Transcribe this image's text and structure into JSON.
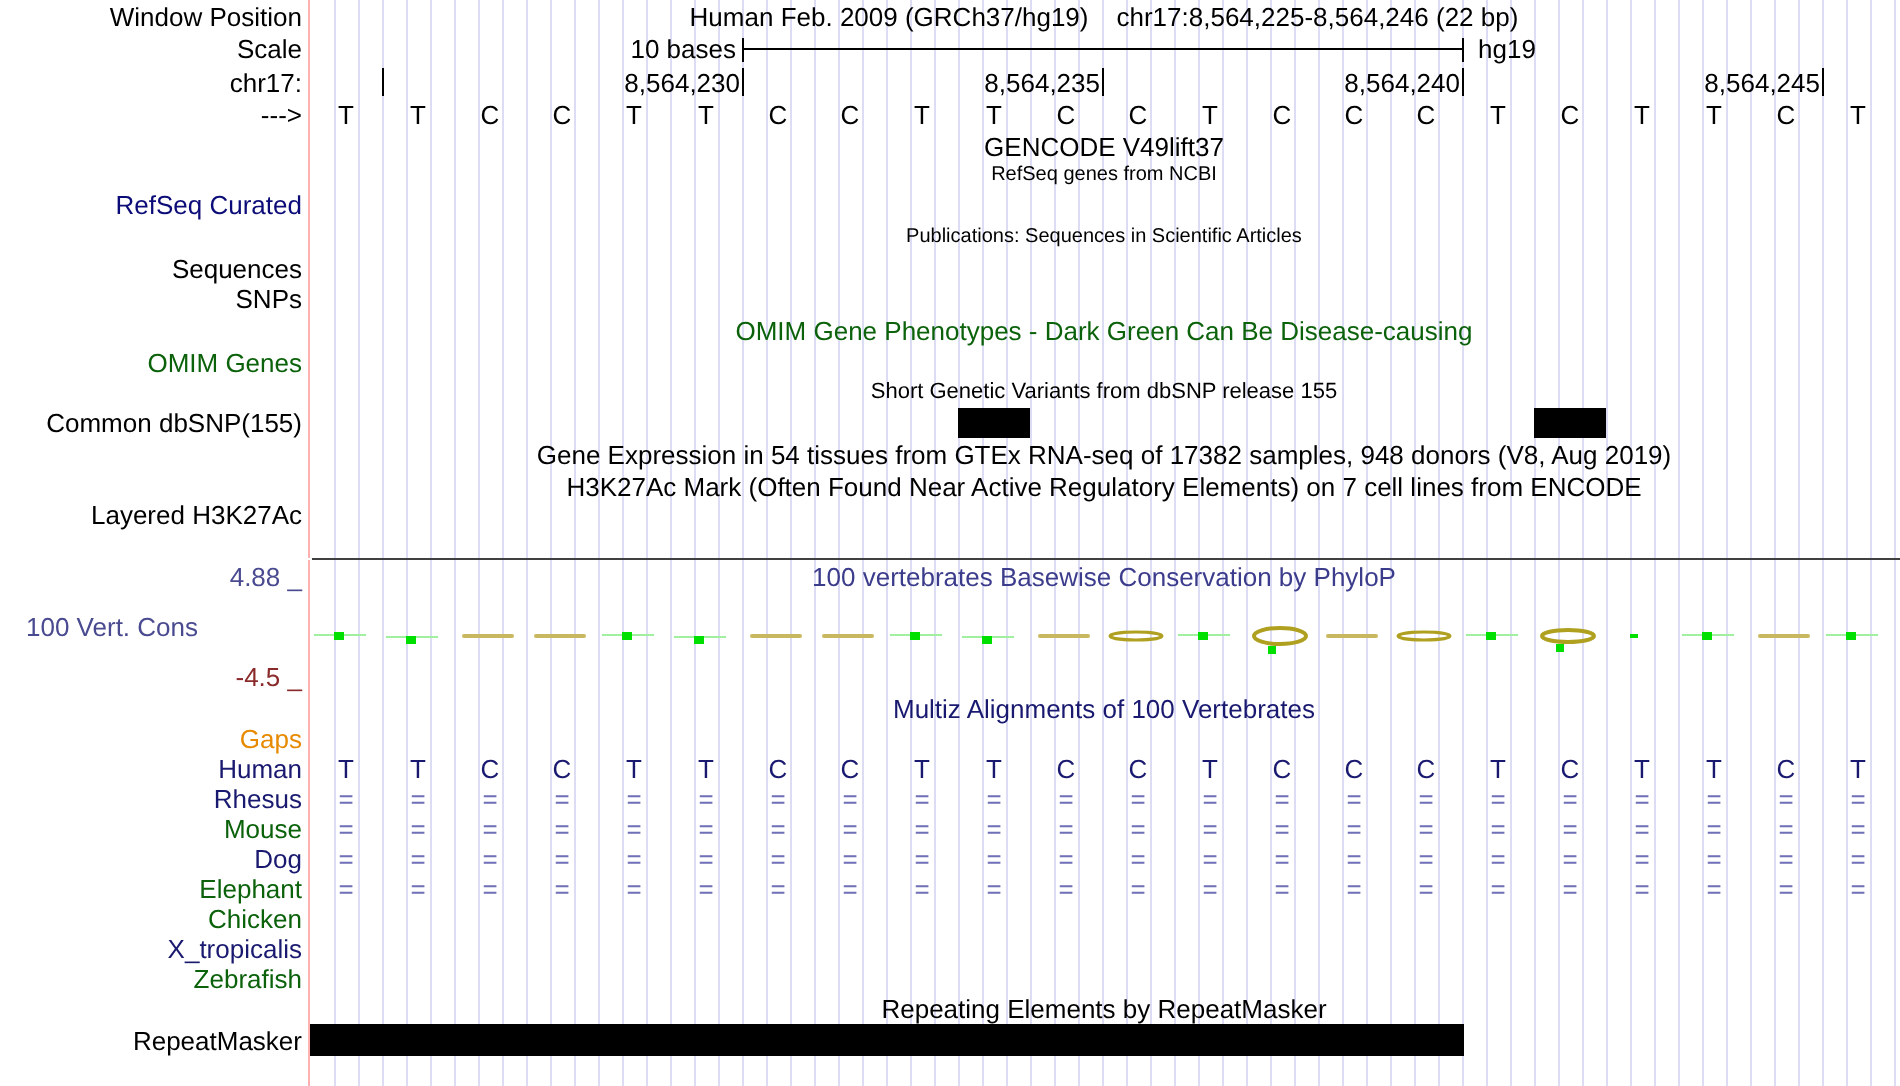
{
  "header": {
    "window_position_label": "Window Position",
    "assembly": "Human Feb. 2009 (GRCh37/hg19)",
    "position": "chr17:8,564,225-8,564,246 (22 bp)",
    "scale_label": "Scale",
    "scale_text": "10 bases",
    "scale_db": "hg19",
    "chrom_label": "chr17:",
    "strand_label": "--->"
  },
  "bases": [
    {
      "base": "T",
      "tick": true,
      "snp": false
    },
    {
      "base": "T",
      "tick": false,
      "snp": false
    },
    {
      "base": "C",
      "tick": false,
      "snp": false
    },
    {
      "base": "C",
      "tick": false,
      "snp": false
    },
    {
      "base": "T",
      "tick": false,
      "snp": false
    },
    {
      "base": "T",
      "tick": true,
      "tick_label": "8,564,230",
      "snp": false
    },
    {
      "base": "C",
      "tick": false,
      "snp": false
    },
    {
      "base": "C",
      "tick": false,
      "snp": false
    },
    {
      "base": "T",
      "tick": false,
      "snp": false
    },
    {
      "base": "T",
      "tick": false,
      "snp": true
    },
    {
      "base": "C",
      "tick": true,
      "tick_label": "8,564,235",
      "snp": false
    },
    {
      "base": "C",
      "tick": false,
      "snp": false
    },
    {
      "base": "T",
      "tick": false,
      "snp": false
    },
    {
      "base": "C",
      "tick": false,
      "snp": false
    },
    {
      "base": "C",
      "tick": false,
      "snp": false
    },
    {
      "base": "C",
      "tick": true,
      "tick_label": "8,564,240",
      "snp": false
    },
    {
      "base": "T",
      "tick": false,
      "snp": false
    },
    {
      "base": "C",
      "tick": false,
      "snp": true
    },
    {
      "base": "T",
      "tick": false,
      "snp": false
    },
    {
      "base": "T",
      "tick": false,
      "snp": false
    },
    {
      "base": "C",
      "tick": true,
      "tick_label": "8,564,245",
      "snp": false
    },
    {
      "base": "T",
      "tick": false,
      "snp": false
    }
  ],
  "gencode_title": "GENCODE V49lift37",
  "refseq_title": "RefSeq genes from NCBI",
  "refseq_label": "RefSeq Curated",
  "publications_title": "Publications: Sequences in Scientific Articles",
  "sequences_label": "Sequences",
  "snps_label": "SNPs",
  "omim_title": "OMIM Gene Phenotypes - Dark Green Can Be Disease-causing",
  "omim_label": "OMIM Genes",
  "dbsnp_title": "Short Genetic Variants from dbSNP release 155",
  "dbsnp_label": "Common dbSNP(155)",
  "gtex_title": "Gene Expression in 54 tissues from GTEx RNA-seq of 17382 samples, 948 donors (V8, Aug 2019)",
  "h3k27ac_title": "H3K27Ac Mark (Often Found Near Active Regulatory Elements) on 7 cell lines from ENCODE",
  "h3k27ac_label": "Layered H3K27Ac",
  "conservation": {
    "title": "100 vertebrates Basewise Conservation by PhyloP",
    "label": "100 Vert. Cons",
    "max": "4.88 _",
    "min": "-4.5 _"
  },
  "multiz": {
    "title": "Multiz Alignments of 100 Vertebrates",
    "gaps_label": "Gaps",
    "species": [
      {
        "name": "Human",
        "color": "#191970",
        "bases": [
          "T",
          "T",
          "C",
          "C",
          "T",
          "T",
          "C",
          "C",
          "T",
          "T",
          "C",
          "C",
          "T",
          "C",
          "C",
          "C",
          "T",
          "C",
          "T",
          "T",
          "C",
          "T"
        ]
      },
      {
        "name": "Rhesus",
        "color": "#191970",
        "bases": [
          "=",
          "=",
          "=",
          "=",
          "=",
          "=",
          "=",
          "=",
          "=",
          "=",
          "=",
          "=",
          "=",
          "=",
          "=",
          "=",
          "=",
          "=",
          "=",
          "=",
          "=",
          "="
        ]
      },
      {
        "name": "Mouse",
        "color": "#0b620b",
        "bases": [
          "=",
          "=",
          "=",
          "=",
          "=",
          "=",
          "=",
          "=",
          "=",
          "=",
          "=",
          "=",
          "=",
          "=",
          "=",
          "=",
          "=",
          "=",
          "=",
          "=",
          "=",
          "="
        ]
      },
      {
        "name": "Dog",
        "color": "#191970",
        "bases": [
          "=",
          "=",
          "=",
          "=",
          "=",
          "=",
          "=",
          "=",
          "=",
          "=",
          "=",
          "=",
          "=",
          "=",
          "=",
          "=",
          "=",
          "=",
          "=",
          "=",
          "=",
          "="
        ]
      },
      {
        "name": "Elephant",
        "color": "#0b620b",
        "bases": [
          "=",
          "=",
          "=",
          "=",
          "=",
          "=",
          "=",
          "=",
          "=",
          "=",
          "=",
          "=",
          "=",
          "=",
          "=",
          "=",
          "=",
          "=",
          "=",
          "=",
          "=",
          "="
        ]
      },
      {
        "name": "Chicken",
        "color": "#0b620b"
      },
      {
        "name": "X_tropicalis",
        "color": "#191970"
      },
      {
        "name": "Zebrafish",
        "color": "#0b620b"
      }
    ]
  },
  "repeatmasker": {
    "title": "Repeating Elements by RepeatMasker",
    "label": "RepeatMasker"
  }
}
